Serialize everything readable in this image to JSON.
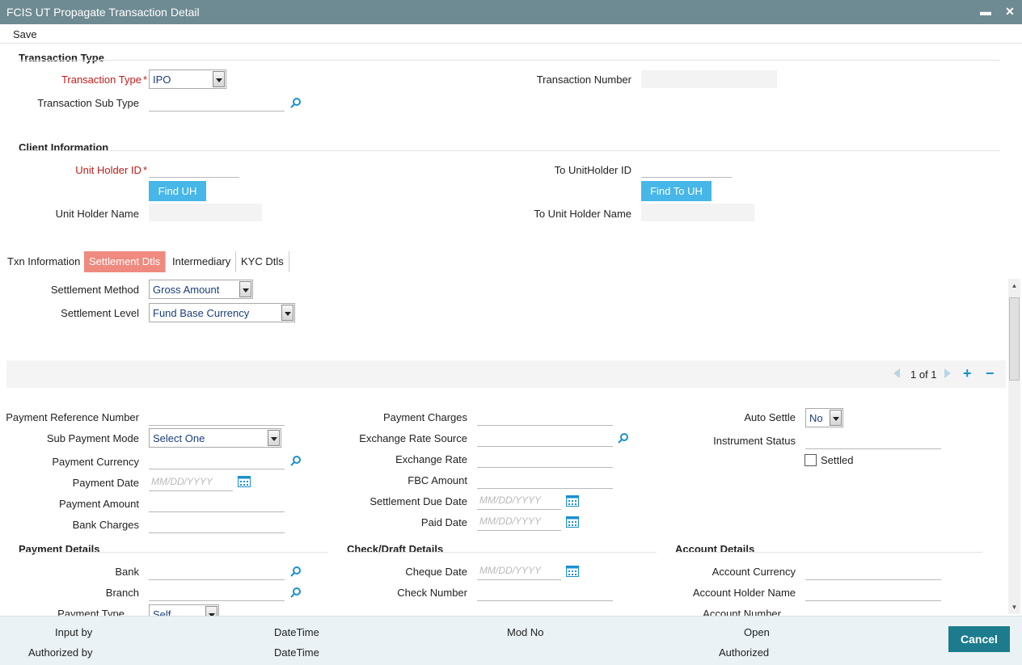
{
  "window": {
    "title": "FCIS UT Propagate Transaction Detail",
    "minimize": "▬",
    "close": "✕"
  },
  "menu": {
    "save_label": "Save"
  },
  "transaction_type": {
    "header": "Transaction Type",
    "type_label": "Transaction Type",
    "type_value": "IPO",
    "sub_type_label": "Transaction Sub Type",
    "number_label": "Transaction Number"
  },
  "client_info": {
    "header": "Client Information",
    "uh_id_label": "Unit Holder ID",
    "find_uh_label": "Find UH",
    "uh_name_label": "Unit Holder Name",
    "to_uh_id_label": "To UnitHolder ID",
    "find_to_uh_label": "Find To UH",
    "to_uh_name_label": "To Unit Holder Name"
  },
  "required_marker": "*",
  "tabs": [
    {
      "label": "Txn Information",
      "active": false
    },
    {
      "label": "Settlement Dtls",
      "active": true
    },
    {
      "label": "Intermediary",
      "active": false
    },
    {
      "label": "KYC Dtls",
      "active": false
    }
  ],
  "settlement": {
    "method_label": "Settlement Method",
    "method_value": "Gross Amount",
    "level_label": "Settlement Level",
    "level_value": "Fund Base Currency"
  },
  "pager": {
    "text": "1 of 1",
    "add": "+",
    "remove": "−"
  },
  "payment": {
    "ref_label": "Payment Reference Number",
    "sub_mode_label": "Sub Payment Mode",
    "sub_mode_value": "Select One",
    "currency_label": "Payment Currency",
    "date_label": "Payment Date",
    "amount_label": "Payment Amount",
    "bank_charges_label": "Bank Charges",
    "charges_label": "Payment Charges",
    "xrate_source_label": "Exchange Rate Source",
    "xrate_label": "Exchange Rate",
    "fbc_label": "FBC Amount",
    "settle_due_label": "Settlement Due Date",
    "paid_date_label": "Paid Date",
    "auto_settle_label": "Auto Settle",
    "auto_settle_value": "No",
    "instrument_status_label": "Instrument Status",
    "settled_label": "Settled",
    "date_placeholder": "MM/DD/YYYY"
  },
  "payment_details": {
    "header": "Payment Details",
    "bank_label": "Bank",
    "branch_label": "Branch",
    "payment_type_label": "Payment Type",
    "payment_type_value": "Self"
  },
  "check_details": {
    "header": "Check/Draft Details",
    "cheque_date_label": "Cheque Date",
    "check_number_label": "Check Number"
  },
  "account_details": {
    "header": "Account Details",
    "currency_label": "Account Currency",
    "holder_label": "Account Holder Name",
    "number_label": "Account Number"
  },
  "footer": {
    "input_by": "Input by",
    "datetime1": "DateTime",
    "mod_no": "Mod No",
    "open": "Open",
    "authorized_by": "Authorized by",
    "datetime2": "DateTime",
    "authorized": "Authorized",
    "cancel_label": "Cancel"
  },
  "colors": {
    "titlebar": "#6e8a92",
    "active_tab": "#ef8a80",
    "button_blue": "#47b6e8",
    "cancel": "#1c7c8e",
    "required": "#c41b1b"
  }
}
